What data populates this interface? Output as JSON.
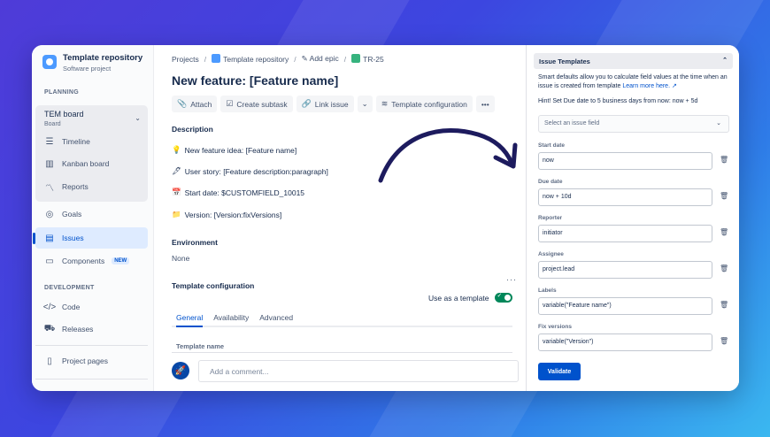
{
  "sidebar": {
    "project_name": "Template repository",
    "project_type": "Software project",
    "planning_label": "PLANNING",
    "board": {
      "title": "TEM board",
      "subtitle": "Board"
    },
    "planning_items": [
      {
        "label": "Timeline",
        "icon": "timeline-icon"
      },
      {
        "label": "Kanban board",
        "icon": "kanban-icon"
      },
      {
        "label": "Reports",
        "icon": "reports-icon"
      }
    ],
    "items": [
      {
        "label": "Goals",
        "icon": "goals-icon"
      },
      {
        "label": "Issues",
        "icon": "issues-icon",
        "active": true
      },
      {
        "label": "Components",
        "icon": "components-icon",
        "badge": "NEW"
      }
    ],
    "development_label": "DEVELOPMENT",
    "dev_items": [
      {
        "label": "Code",
        "icon": "code-icon"
      },
      {
        "label": "Releases",
        "icon": "releases-icon"
      }
    ],
    "project_pages": "Project pages"
  },
  "breadcrumb": {
    "projects": "Projects",
    "repo": "Template repository",
    "epic": "Add epic",
    "issue": "TR-25"
  },
  "issue": {
    "title": "New feature: [Feature name]",
    "toolbar": {
      "attach": "Attach",
      "subtask": "Create subtask",
      "link": "Link issue",
      "config": "Template configuration"
    },
    "description_heading": "Description",
    "description_lines": [
      {
        "emoji": "💡",
        "text": "New feature idea: [Feature name]"
      },
      {
        "emoji": "🖋",
        "text": "User story: [Feature description:paragraph]"
      },
      {
        "emoji": "📅",
        "text": "Start date: $CUSTOMFIELD_10015"
      },
      {
        "emoji": "📁",
        "text": "Version: [Version:fixVersions]"
      }
    ],
    "environment_heading": "Environment",
    "environment_value": "None",
    "template_config_heading": "Template configuration",
    "use_as_template": "Use as a template",
    "use_as_template_on": true,
    "tabs": [
      "General",
      "Availability",
      "Advanced"
    ],
    "active_tab": "General",
    "template_name_label": "Template name",
    "comment_placeholder": "Add a comment..."
  },
  "panel": {
    "title": "Issue Templates",
    "intro": "Smart defaults allow you to calculate field values at the time when an issue is created from template",
    "learn_more": "Learn more here.",
    "hint": "Hint! Set Due date to 5 business days from now: now + 5d",
    "select_placeholder": "Select an issue field",
    "fields": [
      {
        "label": "Start date",
        "value": "now"
      },
      {
        "label": "Due date",
        "value": "now + 10d"
      },
      {
        "label": "Reporter",
        "value": "initiator"
      },
      {
        "label": "Assignee",
        "value": "project.lead"
      },
      {
        "label": "Labels",
        "value": "variable(\"Feature name\")"
      },
      {
        "label": "Fix versions",
        "value": "variable(\"Version\")"
      }
    ],
    "validate": "Validate"
  },
  "colors": {
    "accent": "#0052cc",
    "toggle_on": "#00875a",
    "arrow": "#1d1b5e"
  }
}
